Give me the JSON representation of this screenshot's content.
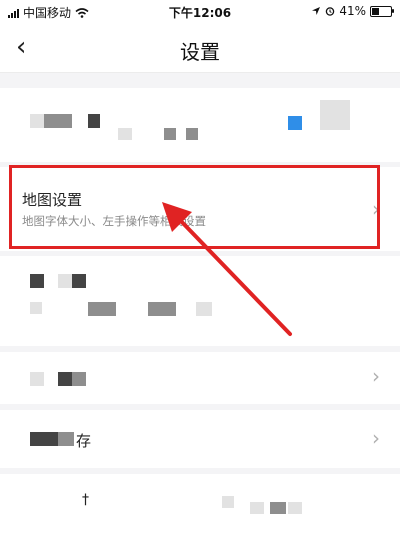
{
  "status_bar": {
    "carrier": "中国移动",
    "time": "下午12:06",
    "battery_percent": "41%",
    "battery_level": 0.41
  },
  "nav": {
    "back_icon": "chevron-left-icon",
    "title": "设置"
  },
  "map_settings": {
    "label": "地图设置",
    "description": "地图字体大小、左手操作等相关设置"
  },
  "storage_row": {
    "label_tail": "存"
  },
  "bottom_row": {
    "glyph": "†"
  },
  "colors": {
    "highlight": "#e02323",
    "accent_blue": "#2f8ee8"
  }
}
